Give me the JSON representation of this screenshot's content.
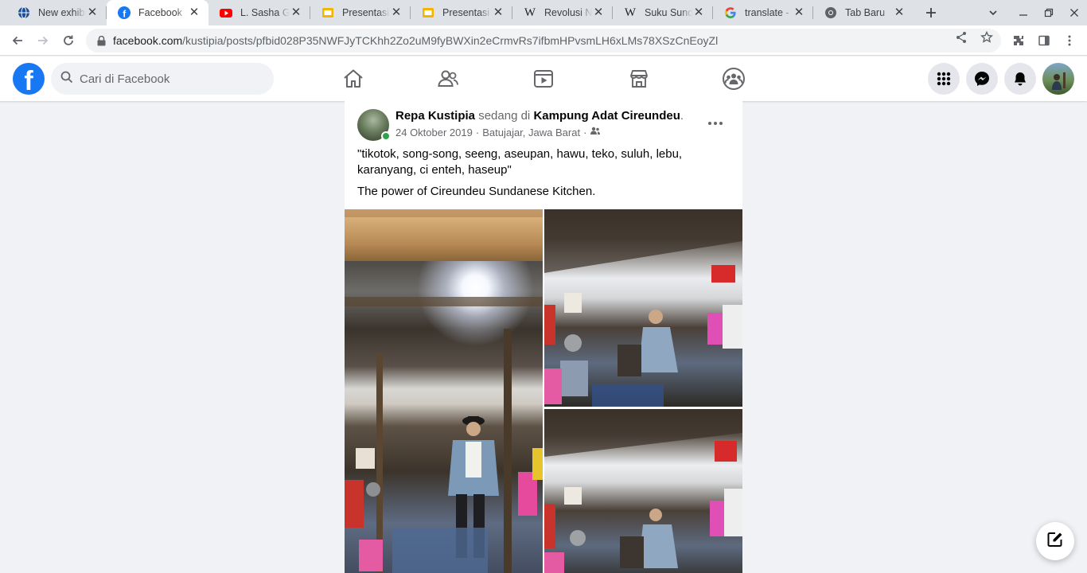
{
  "browser": {
    "tabs": [
      {
        "title": "New exhibit",
        "icon": "globe-icon"
      },
      {
        "title": "Facebook",
        "icon": "facebook-icon"
      },
      {
        "title": "L. Sasha Go",
        "icon": "youtube-icon"
      },
      {
        "title": "Presentasi",
        "icon": "slides-icon"
      },
      {
        "title": "Presentasi",
        "icon": "slides-icon"
      },
      {
        "title": "Revolusi Na",
        "icon": "wikipedia-icon"
      },
      {
        "title": "Suku Sunda",
        "icon": "wikipedia-icon"
      },
      {
        "title": "translate - F",
        "icon": "google-icon"
      },
      {
        "title": "Tab Baru",
        "icon": "chrome-icon"
      }
    ],
    "active_tab": 1,
    "url_host": "facebook.com",
    "url_path": "/kustipia/posts/pfbid028P35NWFJyTCKhh2Zo2uM9fyBWXin2eCrmvRs7ifbmHPvsmLH6xLMs78XSzCnEoyZl"
  },
  "facebook": {
    "search_placeholder": "Cari di Facebook",
    "brand_color": "#1877f2"
  },
  "post": {
    "author": "Repa Kustipia",
    "checkin_text": "sedang di",
    "place": "Kampung Adat Cireundeu",
    "date": "24 Oktober 2019",
    "location": "Batujajar, Jawa Barat",
    "separator": "·",
    "text_line1": "\"tikotok, song-song, seeng, aseupan, hawu, teko, suluh, lebu, karanyang, ci enteh, haseup\"",
    "text_line2": "The power of Cireundeu Sundanese Kitchen."
  }
}
